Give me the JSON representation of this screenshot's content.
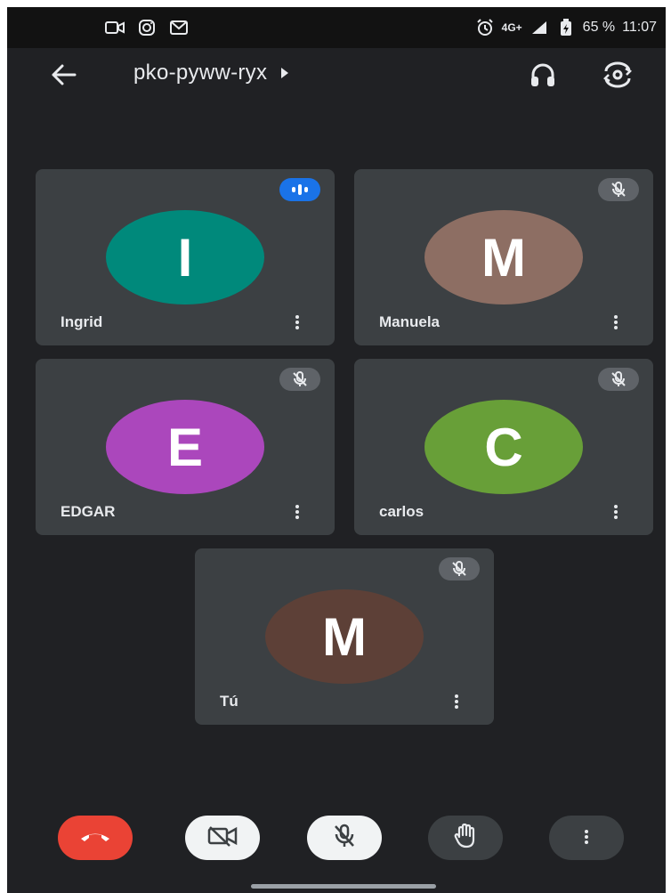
{
  "status_bar": {
    "icons_left": [
      "video-notification-icon",
      "instagram-icon",
      "gmail-icon"
    ],
    "alarm_icon": "alarm-icon",
    "network_label": "4G+",
    "battery": "65 %",
    "time": "11:07"
  },
  "header": {
    "meeting_code": "pko-pyww-ryx",
    "back_icon": "arrow-left-icon",
    "audio_icon": "headphones-icon",
    "switch_camera_icon": "switch-camera-icon"
  },
  "participants": [
    {
      "name": "Ingrid",
      "initial": "I",
      "color": "#00897b",
      "speaking": true,
      "muted": false
    },
    {
      "name": "Manuela",
      "initial": "M",
      "color": "#8d6e63",
      "speaking": false,
      "muted": true
    },
    {
      "name": "EDGAR",
      "initial": "E",
      "color": "#ab47bc",
      "speaking": false,
      "muted": true
    },
    {
      "name": "carlos",
      "initial": "C",
      "color": "#689f38",
      "speaking": false,
      "muted": true
    },
    {
      "name": "Tú",
      "initial": "M",
      "color": "#5d4037",
      "speaking": false,
      "muted": true
    }
  ],
  "controls": {
    "end_call_color": "#ea4335",
    "items": [
      "end-call",
      "camera-off",
      "mic-off",
      "raise-hand",
      "more-options"
    ]
  }
}
